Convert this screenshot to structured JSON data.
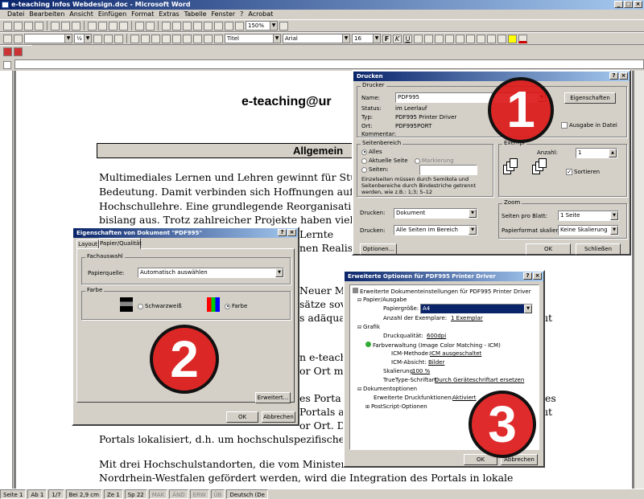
{
  "window": {
    "title": "e-teaching Infos Webdesign.doc - Microsoft Word"
  },
  "menu": [
    "Datei",
    "Bearbeiten",
    "Ansicht",
    "Einfügen",
    "Format",
    "Extras",
    "Tabelle",
    "Fenster",
    "?",
    "Acrobat"
  ],
  "toolbar": {
    "zoom": "150%",
    "style": "Titel",
    "font": "Arial",
    "size": "16",
    "bold": "F",
    "italic": "K",
    "underline": "U",
    "linewidth": "½"
  },
  "document": {
    "heading": "e-teaching@ur",
    "section": "Allgemein",
    "lines": [
      "Multimediales Lernen und Lehren gewinnt für Studi",
      "Bedeutung. Damit verbinden sich Hoffnungen auf e",
      "Hochschullehre. Eine grundlegende Reorganisation",
      "bislang aus. Trotz zahlreicher Projekte haben viele L"
    ],
    "fragments": [
      "Lernte",
      "nen Realis",
      "Neuer Me",
      "sätze sov",
      "s adäqua",
      "n e-teach",
      "or Ort m",
      "es Porta",
      "Portals a",
      "or Ort. D",
      "Portals lokalisiert, d.h. um hochschulspezifische In",
      "Mit drei Hochschulstandorten, die vom Ministeriun",
      "Nordrhein-Westfalen gefördert werden, wird die Integration des Portals in lokale"
    ],
    "right_fragments": [
      "ıt",
      "es",
      "ıt"
    ]
  },
  "status": {
    "page": "Seite 1",
    "section": "Ab 1",
    "pages": "1/7",
    "pos": "Bei 2,9 cm",
    "line": "Ze 1",
    "col": "Sp 22",
    "mak": "MAK",
    "aend": "ÄND",
    "erw": "ERW",
    "ub": "ÜB",
    "lang": "Deutsch (De"
  },
  "print": {
    "title": "Drucken",
    "printer_group": "Drucker",
    "name_label": "Name:",
    "name_value": "PDF995",
    "status_label": "Status:",
    "status_value": "im Leerlauf",
    "type_label": "Typ:",
    "type_value": "PDF995 Printer Driver",
    "location_label": "Ort:",
    "location_value": "PDF995PORT",
    "comment_label": "Kommentar:",
    "properties_button": "Eigenschaften",
    "to_file": "Ausgabe in Datei",
    "range_group": "Seitenbereich",
    "all": "Alles",
    "current": "Aktuelle Seite",
    "selection": "Markierung",
    "pages": "Seiten:",
    "hint": "Einzelseiten müssen durch Semikola und Seitenbereiche durch Bindestriche getrennt werden, wie z.B.: 1;3; 5–12",
    "copies_group": "Exempl",
    "count_label": "Anzahl:",
    "count_value": "1",
    "collate": "Sortieren",
    "print_label": "Drucken:",
    "print_value": "Dokument",
    "print2_label": "Drucken:",
    "print2_value": "Alle Seiten im Bereich",
    "zoom_group": "Zoom",
    "pps_label": "Seiten pro Blatt:",
    "pps_value": "1 Seite",
    "scale_label": "Papierformat skalieren:",
    "scale_value": "Keine Skalierung",
    "options_button": "Optionen...",
    "ok_button": "OK",
    "close_button": "Schließen"
  },
  "props": {
    "title": "Eigenschaften von Dokument \"PDF995\"",
    "tab_layout": "Layout",
    "tab_paper": "Papier/Qualität",
    "paper_group": "Fachauswahl",
    "source_label": "Papierquelle:",
    "source_value": "Automatisch auswählen",
    "color_group": "Farbe",
    "bw": "Schwarzweiß",
    "color": "Farbe",
    "advanced_button": "Erweitert...",
    "ok_button": "OK",
    "cancel_button": "Abbrechen"
  },
  "adv": {
    "title": "Erweiterte Optionen für PDF995 Printer Driver",
    "root": "Erweiterte Dokumenteinstellungen für PDF995 Printer Driver",
    "paper": "Papier/Ausgabe",
    "size_label": "Papiergröße:",
    "size_value": "A4",
    "copies_label": "Anzahl der Exemplare:",
    "copies_value": "1 Exemplar",
    "graphic": "Grafik",
    "quality_label": "Druckqualität:",
    "quality_value": "600dpi",
    "icm": "Farbverwaltung (Image Color Matching - ICM)",
    "icm_method_label": "ICM-Methode:",
    "icm_method_value": "ICM ausgeschaltet",
    "icm_intent_label": "ICM-Absicht:",
    "icm_intent_value": "Bilder",
    "scale_label": "Skalierung:",
    "scale_value": "100 %",
    "tt_label": "TrueType-Schriftart:",
    "tt_value": "Durch Geräteschriftart ersetzen",
    "docopts": "Dokumentoptionen",
    "extfunc_label": "Erweiterte Druckfunktionen:",
    "extfunc_value": "Aktiviert",
    "ps": "PostScript-Optionen",
    "ok_button": "OK",
    "cancel_button": "Abbrechen"
  },
  "markers": {
    "one": "1",
    "two": "2",
    "three": "3"
  }
}
